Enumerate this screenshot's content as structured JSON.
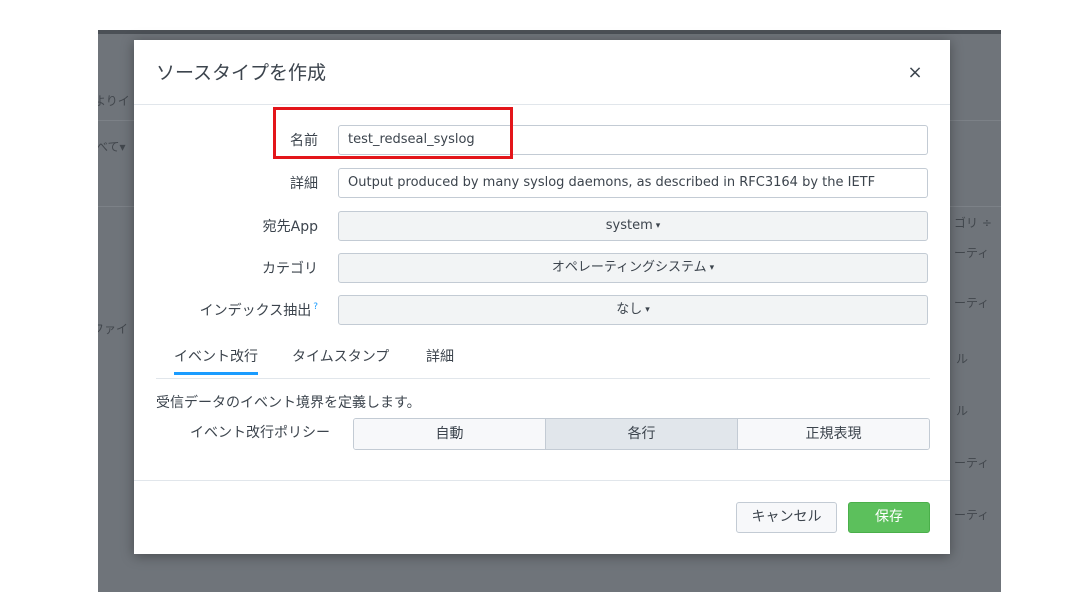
{
  "background": {
    "fragments": [
      "よりイ",
      "べて▾",
      "ファイ",
      "ゴリ ÷",
      "ーティ",
      "ーティ",
      "ル",
      "ル",
      "ーティ",
      "ーティ"
    ]
  },
  "modal": {
    "title": "ソースタイプを作成",
    "close_icon": "×",
    "fields": {
      "name": {
        "label": "名前",
        "value": "test_redseal_syslog"
      },
      "description": {
        "label": "詳細",
        "value": "Output produced by many syslog daemons, as described in RFC3164 by the IETF"
      },
      "app": {
        "label": "宛先App",
        "value": "system"
      },
      "category": {
        "label": "カテゴリ",
        "value": "オペレーティングシステム"
      },
      "index_extraction": {
        "label": "インデックス抽出",
        "help": "?",
        "value": "なし"
      }
    },
    "caret": "▾",
    "tabs": [
      {
        "label": "イベント改行",
        "active": true
      },
      {
        "label": "タイムスタンプ",
        "active": false
      },
      {
        "label": "詳細",
        "active": false
      }
    ],
    "event_breaks": {
      "description": "受信データのイベント境界を定義します。",
      "policy_label": "イベント改行ポリシー",
      "options": [
        "自動",
        "各行",
        "正規表現"
      ],
      "selected": "各行"
    },
    "footer": {
      "cancel_label": "キャンセル",
      "save_label": "保存"
    }
  },
  "colors": {
    "highlight_border": "#e3151a",
    "save_button": "#5cc05c",
    "tab_active_underline": "#1a9cff",
    "overlay": "#6f747a"
  }
}
